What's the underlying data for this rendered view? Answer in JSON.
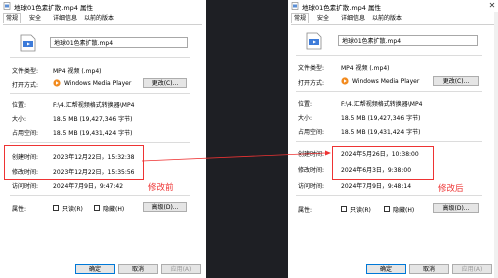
{
  "left": {
    "title": "地球01色素扩散.mp4 属性",
    "tabs": [
      "常规",
      "安全",
      "详细信息",
      "以前的版本"
    ],
    "filename": "地球01色素扩散.mp4",
    "file_type_label": "文件类型:",
    "file_type": "MP4 视频 (.mp4)",
    "open_with_label": "打开方式:",
    "open_with": "Windows Media Player",
    "change_btn": "更改(C)...",
    "location_label": "位置:",
    "location": "F:\\4.汇帮视频格式转换器\\MP4",
    "size_label": "大小:",
    "size": "18.5 MB (19,427,346 字节)",
    "disk_label": "占用空间:",
    "disk": "18.5 MB (19,431,424 字节)",
    "created_label": "创建时间:",
    "created": "2023年12月22日，15:32:38",
    "modified_label": "修改时间:",
    "modified": "2023年12月22日，15:35:56",
    "accessed_label": "访问时间:",
    "accessed": "2024年7月9日，9:47:42",
    "attr_label": "属性:",
    "readonly": "只读(R)",
    "hidden": "隐藏(H)",
    "advanced_btn": "高级(D)...",
    "ok": "确定",
    "cancel": "取消",
    "apply": "应用(A)",
    "annotation": "修改前"
  },
  "right": {
    "title": "地球01色素扩散.mp4 属性",
    "tabs": [
      "常规",
      "安全",
      "详细信息",
      "以前的版本"
    ],
    "filename": "地球01色素扩散.mp4",
    "file_type_label": "文件类型:",
    "file_type": "MP4 视频 (.mp4)",
    "open_with_label": "打开方式:",
    "open_with": "Windows Media Player",
    "change_btn": "更改(C)...",
    "location_label": "位置:",
    "location": "F:\\4.汇帮视频格式转换器\\MP4",
    "size_label": "大小:",
    "size": "18.5 MB (19,427,346 字节)",
    "disk_label": "占用空间:",
    "disk": "18.5 MB (19,431,424 字节)",
    "created_label": "创建时间:",
    "created": "2024年5月26日，10:38:00",
    "modified_label": "修改时间:",
    "modified": "2024年6月3日，9:38:00",
    "accessed_label": "访问时间:",
    "accessed": "2024年7月9日，9:48:14",
    "attr_label": "属性:",
    "readonly": "只读(R)",
    "hidden": "隐藏(H)",
    "advanced_btn": "高级(D)...",
    "ok": "确定",
    "cancel": "取消",
    "apply": "应用(A)",
    "annotation": "修改后"
  },
  "colors": {
    "annotation": "#e33333",
    "accent": "#0078d7",
    "background": "#1e1f24"
  },
  "icons": [
    "video-file-icon",
    "windows-media-player-icon",
    "close-icon",
    "arrow-icon"
  ]
}
